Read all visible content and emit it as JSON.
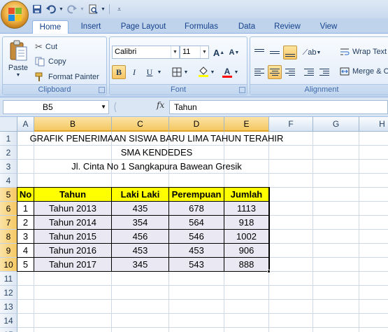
{
  "app": {
    "colors": {
      "accent": "#15428b",
      "header_fill": "#ffff00",
      "data_fill": "#e9e8f3",
      "selected_header": "#f5c862"
    }
  },
  "quick_access": {
    "icons": [
      "save-icon",
      "undo-icon",
      "redo-icon",
      "print-preview-icon",
      "customize-icon"
    ]
  },
  "tabs": [
    {
      "label": "Home",
      "active": true
    },
    {
      "label": "Insert",
      "active": false
    },
    {
      "label": "Page Layout",
      "active": false
    },
    {
      "label": "Formulas",
      "active": false
    },
    {
      "label": "Data",
      "active": false
    },
    {
      "label": "Review",
      "active": false
    },
    {
      "label": "View",
      "active": false
    }
  ],
  "ribbon": {
    "clipboard": {
      "label": "Clipboard",
      "paste": "Paste",
      "cut": "Cut",
      "copy": "Copy",
      "format_painter": "Format Painter"
    },
    "font": {
      "label": "Font",
      "font_name": "Calibri",
      "font_size": "11",
      "bold": "B",
      "italic": "I",
      "underline": "U",
      "grow": "A",
      "shrink": "A",
      "font_color_letter": "A",
      "font_color": "#ff0000",
      "fill_color": "#ffff00"
    },
    "alignment": {
      "label": "Alignment",
      "wrap_text": "Wrap Text",
      "merge_center": "Merge & C"
    }
  },
  "formula_bar": {
    "name_box": "B5",
    "fx": "fx",
    "content": "Tahun"
  },
  "grid": {
    "columns": [
      "A",
      "B",
      "C",
      "D",
      "E",
      "F",
      "G",
      "H"
    ],
    "selected_columns": [
      "B",
      "C",
      "D",
      "E"
    ],
    "rows": [
      "1",
      "2",
      "3",
      "4",
      "5",
      "6",
      "7",
      "8",
      "9",
      "10",
      "11",
      "12",
      "13",
      "14",
      "15"
    ],
    "selected_rows": [
      "5",
      "6",
      "7",
      "8",
      "9",
      "10"
    ],
    "title_lines": [
      "GRAFIK PENERIMAAN SISWA BARU LIMA TAHUN TERAHIR",
      "SMA KENDEDES",
      "Jl. Cinta No 1 Sangkapura Bawean Gresik"
    ],
    "table_headers": [
      "No",
      "Tahun",
      "Laki Laki",
      "Perempuan",
      "Jumlah"
    ],
    "table_rows": [
      [
        "1",
        "Tahun 2013",
        "435",
        "678",
        "1113"
      ],
      [
        "2",
        "Tahun 2014",
        "354",
        "564",
        "918"
      ],
      [
        "3",
        "Tahun 2015",
        "456",
        "546",
        "1002"
      ],
      [
        "4",
        "Tahun 2016",
        "453",
        "453",
        "906"
      ],
      [
        "5",
        "Tahun 2017",
        "345",
        "543",
        "888"
      ]
    ]
  }
}
